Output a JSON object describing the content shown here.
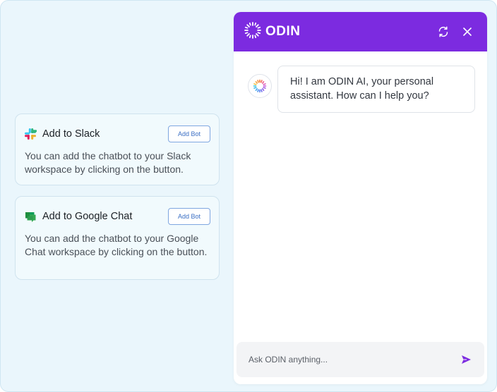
{
  "cards": [
    {
      "title": "Add to Slack",
      "button_label": "Add Bot",
      "description": "You can add the chatbot to your Slack workspace by clicking on the button.",
      "icon": "slack-icon"
    },
    {
      "title": "Add to Google Chat",
      "button_label": "Add Bot",
      "description": "You can add the chatbot to your Google Chat workspace by clicking on the button.",
      "icon": "google-chat-icon"
    }
  ],
  "chat": {
    "brand_name": "ODIN",
    "header_color": "#7c2be0",
    "icons": [
      "odin-logo-icon",
      "refresh-icon",
      "close-icon",
      "bot-avatar-icon",
      "send-icon"
    ],
    "messages": [
      {
        "sender": "bot",
        "text": "Hi! I am ODIN AI, your personal assistant. How can I help you?"
      }
    ],
    "input": {
      "placeholder": "Ask ODIN anything...",
      "value": ""
    }
  },
  "colors": {
    "background": "#eaf6fc",
    "card_background": "#f1fafd",
    "accent": "#7c2be0",
    "button_text": "#3b6fc4"
  }
}
